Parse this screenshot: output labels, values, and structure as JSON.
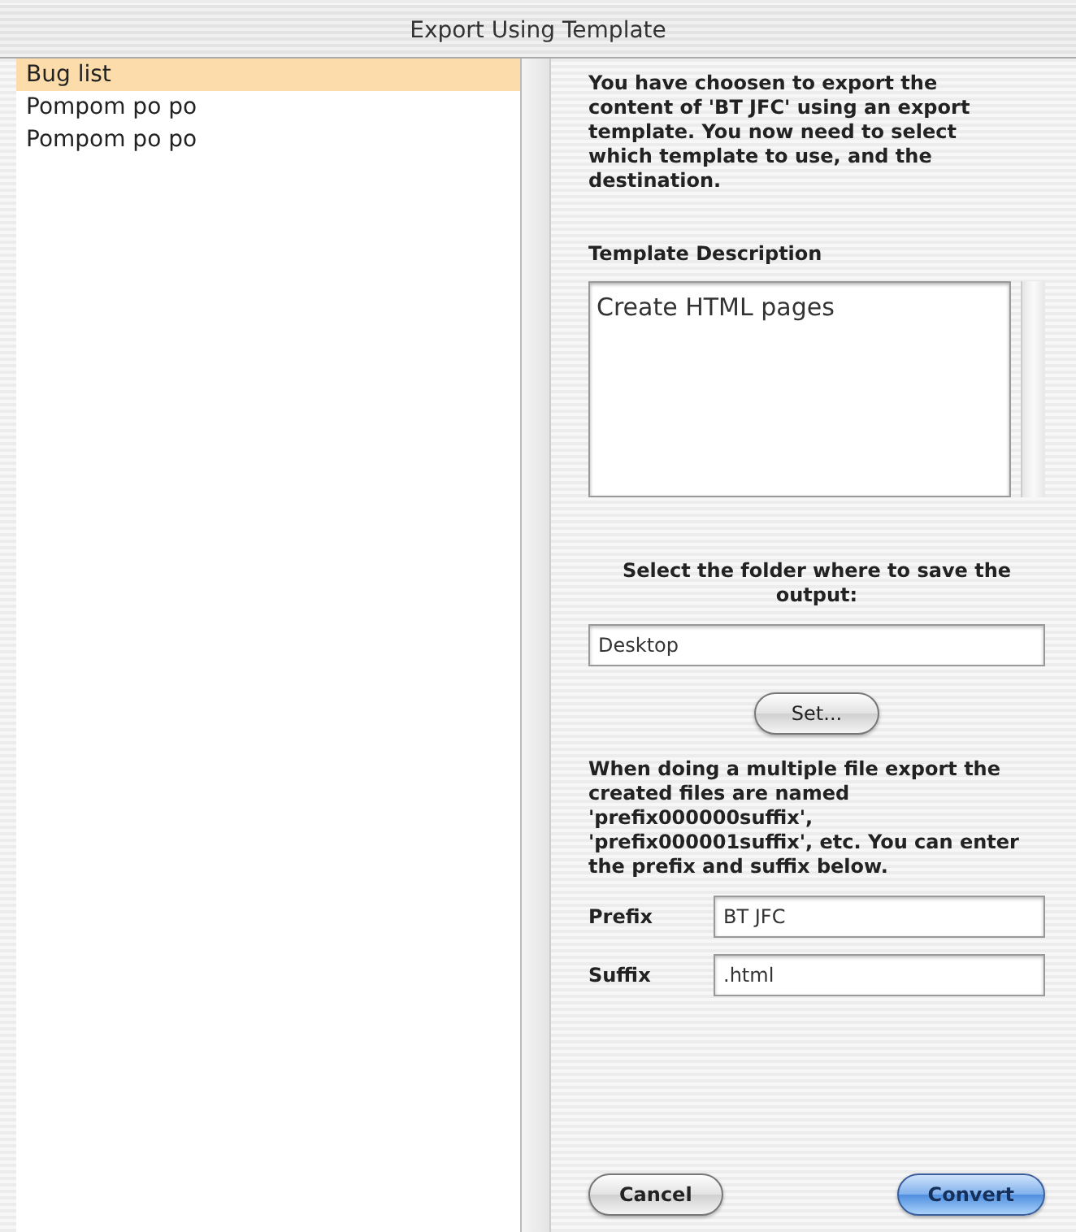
{
  "window": {
    "title": "Export Using Template"
  },
  "template_list": {
    "items": [
      {
        "label": "Bug list",
        "selected": true
      },
      {
        "label": "Pompom po po",
        "selected": false
      },
      {
        "label": "Pompom po po",
        "selected": false
      }
    ]
  },
  "intro_text": "You have choosen to export the content of 'BT JFC' using an export template. You now need to select which template to use, and the destination.",
  "template_description": {
    "label": "Template Description",
    "value": "Create HTML pages"
  },
  "folder": {
    "label": "Select the folder where to save the output:",
    "value": "Desktop",
    "button": "Set..."
  },
  "naming_text": "When doing a multiple file export the created files are named 'prefix000000suffix', 'prefix000001suffix', etc. You can enter the prefix and suffix below.",
  "fields": [
    {
      "label": "Prefix",
      "value": "BT JFC"
    },
    {
      "label": "Suffix",
      "value": ".html"
    }
  ],
  "buttons": [
    {
      "label": "Cancel",
      "default": false
    },
    {
      "label": "Convert",
      "default": true
    }
  ]
}
